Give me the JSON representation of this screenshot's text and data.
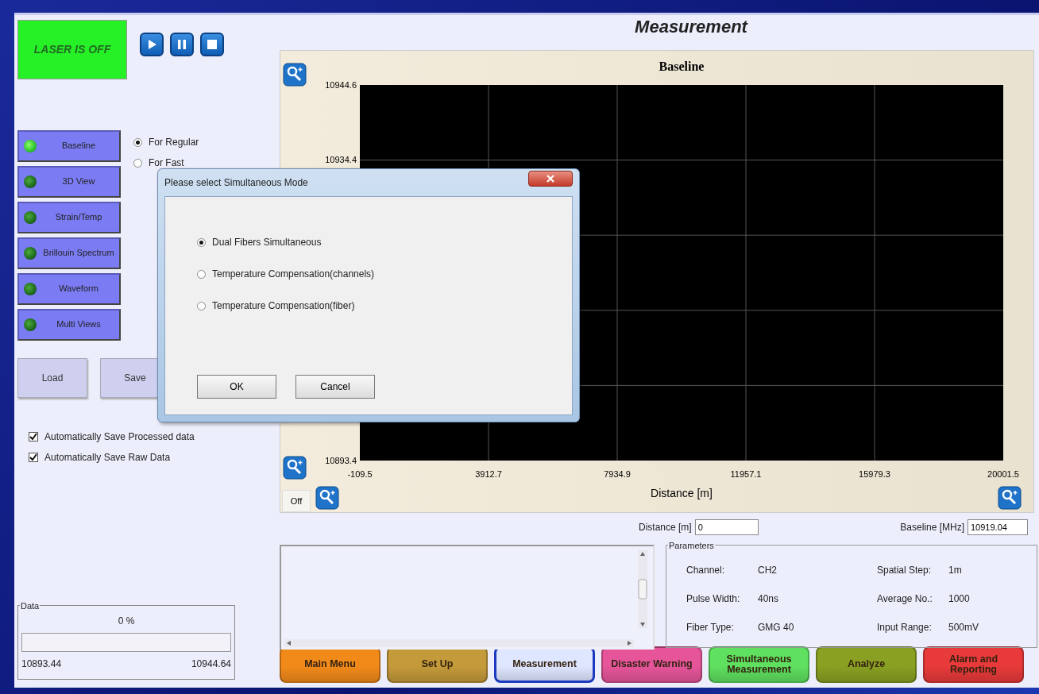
{
  "laser_status": {
    "label": "LASER IS OFF",
    "on": false
  },
  "transport_buttons": [
    {
      "kind": "play"
    },
    {
      "kind": "pause"
    },
    {
      "kind": "stop"
    }
  ],
  "views": [
    {
      "label": "Baseline",
      "lit": true
    },
    {
      "label": "3D View",
      "lit": false
    },
    {
      "label": "Strain/Temp",
      "lit": false
    },
    {
      "label": "Brillouin Spectrum",
      "lit": false
    },
    {
      "label": "Waveform",
      "lit": false
    },
    {
      "label": "Multi Views",
      "lit": false
    }
  ],
  "acquisition_mode": [
    {
      "label": "For Regular",
      "selected": true
    },
    {
      "label": "For Fast",
      "selected": false
    }
  ],
  "file_buttons": [
    "Load",
    "Save"
  ],
  "options": [
    {
      "label": "Automatically Save Processed data",
      "checked": true
    },
    {
      "label": "Automatically Save Raw Data",
      "checked": true
    }
  ],
  "data_group": {
    "title": "Data",
    "percent": "0 %",
    "level": 0,
    "min": "10893.44",
    "max": "10944.64"
  },
  "page_title": "Measurement",
  "chart": {
    "off_button": "Off",
    "chart_data": {
      "type": "line",
      "title": "Baseline",
      "xlabel": "Distance [m]",
      "grid": true,
      "xlim": [
        -109.5,
        20001.5
      ],
      "ylim": [
        10893.4,
        10944.6
      ],
      "xticks": [
        -109.5,
        3912.7,
        7934.9,
        11957.1,
        15979.3,
        20001.5
      ],
      "yticks": [
        10893.4,
        10934.4,
        10944.6
      ]
    }
  },
  "readouts": [
    {
      "label": "Distance [m]",
      "value": "0"
    },
    {
      "label": "Baseline [MHz]",
      "value": "10919.04"
    }
  ],
  "parameters": {
    "title": "Parameters",
    "items": [
      {
        "label": "Channel:",
        "value": "CH2"
      },
      {
        "label": "Spatial Step:",
        "value": "1m"
      },
      {
        "label": "Pulse Width:",
        "value": "40ns"
      },
      {
        "label": "Average No.:",
        "value": "1000"
      },
      {
        "label": "Fiber Type:",
        "value": "GMG 40"
      },
      {
        "label": "Input Range:",
        "value": "500mV"
      }
    ]
  },
  "nav": [
    {
      "label": "Main Menu",
      "color": "#f28a1a",
      "selected": false
    },
    {
      "label": "Set Up",
      "color": "#c49a3a",
      "selected": false
    },
    {
      "label": "Measurement",
      "color": "#dfe6ff",
      "selected": true
    },
    {
      "label": "Disaster Warning",
      "color": "#e6559a",
      "selected": false
    },
    {
      "label": "Simultaneous Measurement",
      "color": "#5fe05f",
      "selected": false
    },
    {
      "label": "Analyze",
      "color": "#8aa022",
      "selected": false
    },
    {
      "label": "Alarm and Reporting",
      "color": "#e83a3a",
      "selected": false
    }
  ],
  "dialog": {
    "title": "Please select Simultaneous Mode",
    "options": [
      {
        "label": "Dual Fibers Simultaneous",
        "selected": true
      },
      {
        "label": "Temperature Compensation(channels)",
        "selected": false
      },
      {
        "label": "Temperature Compensation(fiber)",
        "selected": false
      }
    ],
    "buttons": [
      "OK",
      "Cancel"
    ]
  }
}
